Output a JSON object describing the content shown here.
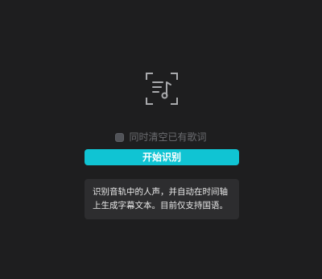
{
  "icons": {
    "music_scan": "music-note-scan-icon"
  },
  "clear_lyrics": {
    "label": "同时清空已有歌词",
    "checked": false
  },
  "start_button": {
    "label": "开始识别"
  },
  "info": {
    "text": "识别音轨中的人声，并自动在时间轴上生成字幕文本。目前仅支持国语。"
  },
  "colors": {
    "background": "#1e1e1f",
    "accent": "#10c4d3",
    "info_background": "#2d2d2f",
    "muted_text": "#6c6d71",
    "icon": "#a9aaad"
  }
}
